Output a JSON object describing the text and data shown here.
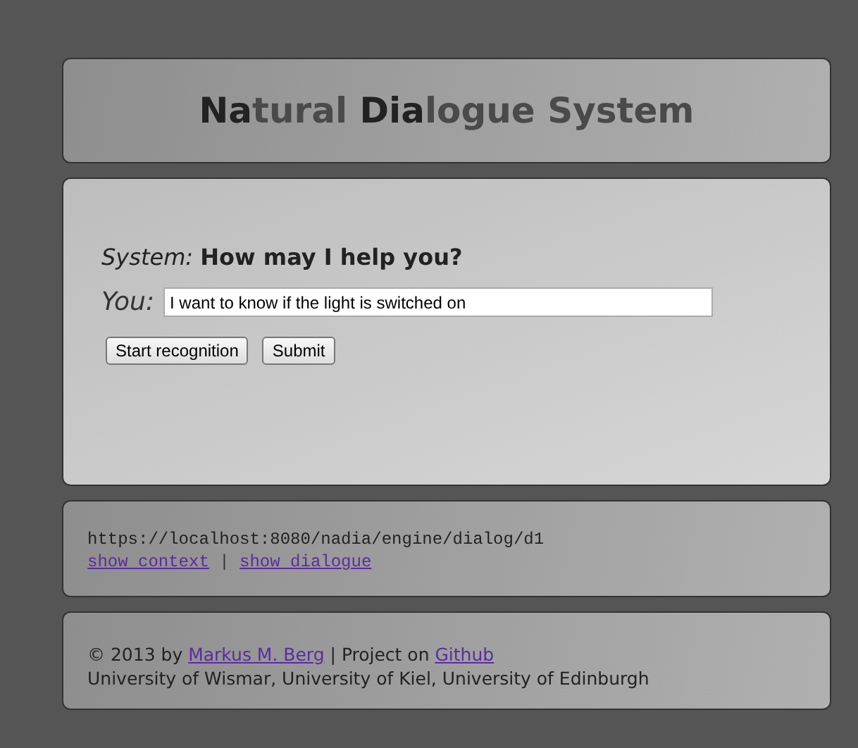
{
  "header": {
    "title_parts": [
      {
        "text": "Na",
        "dark": true
      },
      {
        "text": "tural ",
        "dark": false
      },
      {
        "text": "Dia",
        "dark": true
      },
      {
        "text": "logue System",
        "dark": false
      }
    ]
  },
  "dialog": {
    "system_label": "System:",
    "system_text": "How may I help you?",
    "user_label": "You:",
    "input_value": "I want to know if the light is switched on",
    "buttons": [
      "Start recognition",
      "Submit"
    ]
  },
  "info": {
    "url": "https://localhost:8080/nadia/engine/dialog/d1",
    "links": [
      "show context",
      "show dialogue"
    ],
    "separator": "|"
  },
  "footer": {
    "line1": [
      {
        "kind": "text",
        "text": "© 2013 by "
      },
      {
        "kind": "link",
        "text": "Markus M. Berg"
      },
      {
        "kind": "text",
        "text": " | Project on "
      },
      {
        "kind": "link",
        "text": "Github"
      }
    ],
    "line2": "University of Wismar, University of Kiel, University of Edinburgh"
  }
}
